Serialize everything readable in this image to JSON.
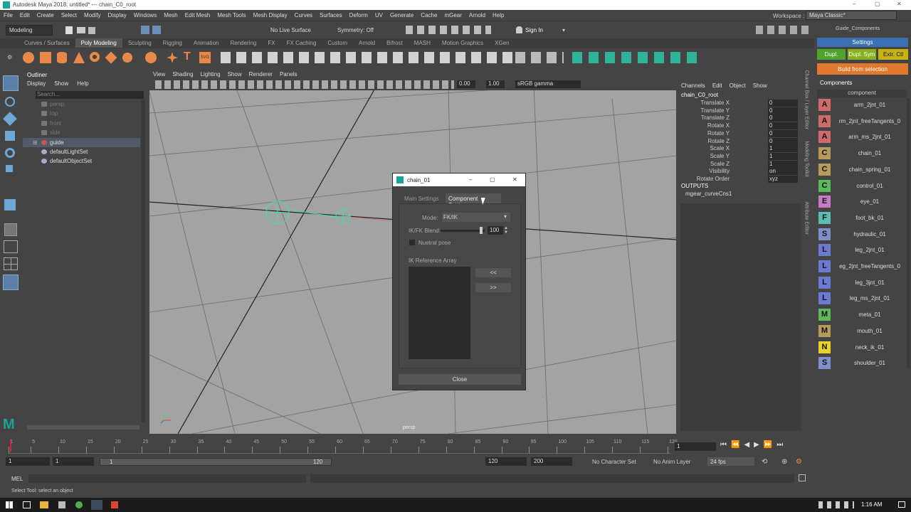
{
  "window": {
    "title": "Autodesk Maya 2018: untitled*   ---   chain_C0_root",
    "minimize": "–",
    "maximize": "▢",
    "close": "✕"
  },
  "menus": [
    "File",
    "Edit",
    "Create",
    "Select",
    "Modify",
    "Display",
    "Windows",
    "Mesh",
    "Edit Mesh",
    "Mesh Tools",
    "Mesh Display",
    "Curves",
    "Surfaces",
    "Deform",
    "UV",
    "Generate",
    "Cache",
    "mGear",
    "Arnold",
    "Help"
  ],
  "workspace": {
    "label": "Workspace :",
    "value": "Maya Classic*"
  },
  "status_line": {
    "mode": "Modeling",
    "live_surface": "No Live Surface",
    "symmetry": "Symmetry: Off",
    "sign_in": "Sign In"
  },
  "shelf_tabs": [
    "Curves / Surfaces",
    "Poly Modeling",
    "Sculpting",
    "Rigging",
    "Animation",
    "Rendering",
    "FX",
    "FX Caching",
    "Custom",
    "Arnold",
    "Bifrost",
    "MASH",
    "Motion Graphics",
    "XGen"
  ],
  "active_shelf": "Poly Modeling",
  "outliner": {
    "title": "Outliner",
    "menu": [
      "Display",
      "Show",
      "Help"
    ],
    "search_placeholder": "Search...",
    "items": [
      {
        "label": "persp",
        "dim": true,
        "expand": ""
      },
      {
        "label": "top",
        "dim": true,
        "expand": ""
      },
      {
        "label": "front",
        "dim": true,
        "expand": ""
      },
      {
        "label": "side",
        "dim": true,
        "expand": ""
      },
      {
        "label": "guide",
        "dim": false,
        "expand": "⊞"
      },
      {
        "label": "defaultLightSet",
        "dim": false,
        "expand": ""
      },
      {
        "label": "defaultObjectSet",
        "dim": false,
        "expand": ""
      }
    ]
  },
  "viewport": {
    "menu": [
      "View",
      "Shading",
      "Lighting",
      "Show",
      "Renderer",
      "Panels"
    ],
    "value_a": "0.00",
    "value_b": "1.00",
    "color_space": "sRGB gamma",
    "camera_label": "persp"
  },
  "channel_box": {
    "menu": [
      "Channels",
      "Edit",
      "Object",
      "Show"
    ],
    "node": "chain_C0_root",
    "attributes": [
      {
        "name": "Translate X",
        "value": "0"
      },
      {
        "name": "Translate Y",
        "value": "0"
      },
      {
        "name": "Translate Z",
        "value": "0"
      },
      {
        "name": "Rotate X",
        "value": "0"
      },
      {
        "name": "Rotate Y",
        "value": "0"
      },
      {
        "name": "Rotate Z",
        "value": "0"
      },
      {
        "name": "Scale X",
        "value": "1"
      },
      {
        "name": "Scale Y",
        "value": "1"
      },
      {
        "name": "Scale Z",
        "value": "1"
      },
      {
        "name": "Visibility",
        "value": "on"
      },
      {
        "name": "Rotate Order",
        "value": "xyz"
      }
    ],
    "outputs_label": "OUTPUTS",
    "output_node": "mgear_curveCns1"
  },
  "side_tabs": [
    "Channel Box / Layer Editor",
    "Modeling Toolkit",
    "Attribute Editor"
  ],
  "guide_panel": {
    "title": "Guide_Components",
    "settings_label": "Settings",
    "dupl": "Dupl.",
    "dupl_sym": "Dupl. Sym",
    "extr_ctl": "Extr. Ctl",
    "build": "Build from selection",
    "components_label": "Components",
    "filter_value": "component",
    "components": [
      {
        "letter": "A",
        "name": "arm_2jnt_01",
        "color": "#d06a6a"
      },
      {
        "letter": "A",
        "name": "rm_2jnt_freeTangents_0",
        "color": "#d06a6a"
      },
      {
        "letter": "A",
        "name": "arm_ms_2jnt_01",
        "color": "#d06a6a"
      },
      {
        "letter": "C",
        "name": "chain_01",
        "color": "#b89a5a"
      },
      {
        "letter": "C",
        "name": "chain_spring_01",
        "color": "#b89a5a"
      },
      {
        "letter": "C",
        "name": "control_01",
        "color": "#5bb85b"
      },
      {
        "letter": "E",
        "name": "eye_01",
        "color": "#c77ac7"
      },
      {
        "letter": "F",
        "name": "foot_bk_01",
        "color": "#5bbdb5"
      },
      {
        "letter": "S",
        "name": "hydraulic_01",
        "color": "#7f8fc9"
      },
      {
        "letter": "L",
        "name": "leg_2jnt_01",
        "color": "#6a7ad0"
      },
      {
        "letter": "L",
        "name": "eg_2jnt_freeTangents_0",
        "color": "#6a7ad0"
      },
      {
        "letter": "L",
        "name": "leg_3jnt_01",
        "color": "#6a7ad0"
      },
      {
        "letter": "L",
        "name": "leg_ms_2jnt_01",
        "color": "#6a7ad0"
      },
      {
        "letter": "M",
        "name": "meta_01",
        "color": "#5bb85b"
      },
      {
        "letter": "M",
        "name": "mouth_01",
        "color": "#b89a5a"
      },
      {
        "letter": "N",
        "name": "neck_ik_01",
        "color": "#e6d22a"
      },
      {
        "letter": "S",
        "name": "shoulder_01",
        "color": "#7f8fc9"
      }
    ]
  },
  "dialog": {
    "title": "chain_01",
    "tabs": [
      "Main Settings",
      "Component Settings"
    ],
    "active_tab": "Component Settings",
    "mode_label": "Mode:",
    "mode_value": "FK/IK",
    "blend_label": "IK/FK Blend:",
    "blend_value": "100",
    "blend_fraction": 0.92,
    "neutral_pose": "Nuetral pose",
    "ik_ref_label": "IK Reference Array",
    "add_button": "<<",
    "remove_button": ">>",
    "close_button": "Close"
  },
  "time_slider": {
    "ticks": [
      "1",
      "5",
      "10",
      "15",
      "20",
      "25",
      "30",
      "35",
      "40",
      "45",
      "50",
      "55",
      "60",
      "65",
      "70",
      "75",
      "80",
      "85",
      "90",
      "95",
      "100",
      "105",
      "110",
      "115",
      "120"
    ],
    "current_frame": "1"
  },
  "range_slider": {
    "start": "1",
    "anim_start": "1",
    "range_start": "1",
    "range_end": "120",
    "playback_end": "120",
    "anim_end": "200",
    "character_set": "No Character Set",
    "anim_layer": "No Anim Layer",
    "fps": "24 fps"
  },
  "mel": {
    "label": "MEL"
  },
  "help_line": "Select Tool: select an object",
  "taskbar": {
    "time": "1:16 AM"
  }
}
